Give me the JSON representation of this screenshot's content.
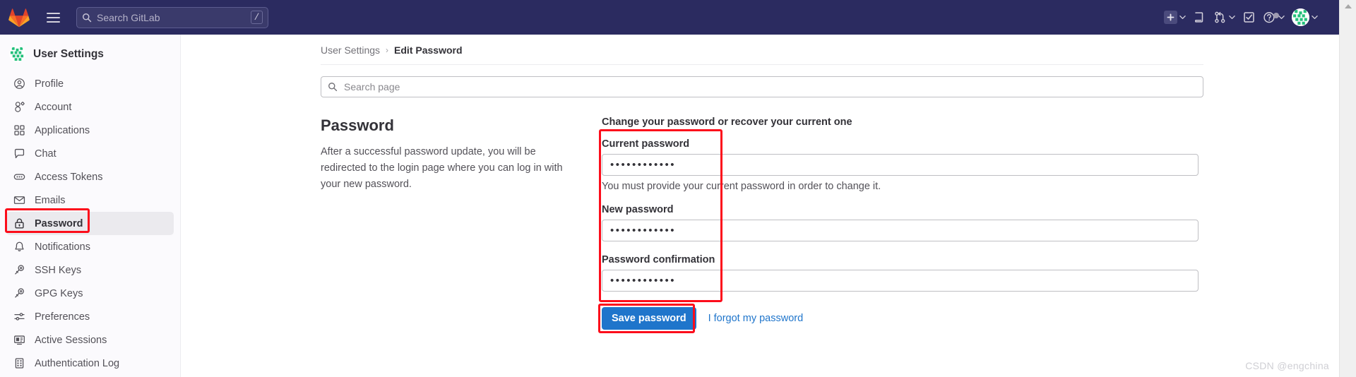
{
  "navbar": {
    "logo_icon": "gitlab-logo-icon",
    "hamburger_icon": "hamburger-menu-icon",
    "search": {
      "placeholder": "Search GitLab",
      "value": "",
      "icon": "search-icon",
      "shortcut_key": "/"
    },
    "actions": [
      {
        "name": "create-new-menu",
        "icon": "plus-square-icon",
        "has_chevron": true
      },
      {
        "name": "issues-link",
        "icon": "issues-icon",
        "has_chevron": false
      },
      {
        "name": "merge-requests-menu",
        "icon": "merge-request-icon",
        "has_chevron": true
      },
      {
        "name": "todos-link",
        "icon": "todo-check-square-icon",
        "has_chevron": false
      },
      {
        "name": "help-menu",
        "icon": "question-circle-icon",
        "has_chevron": true,
        "badge": true
      },
      {
        "name": "user-menu",
        "icon": "user-avatar-icon",
        "has_chevron": true
      }
    ]
  },
  "sidebar": {
    "header": {
      "title": "User Settings",
      "avatar_icon": "user-avatar-icon"
    },
    "items": [
      {
        "label": "Profile",
        "icon": "user-circle-icon",
        "active": false
      },
      {
        "label": "Account",
        "icon": "account-gear-icon",
        "active": false
      },
      {
        "label": "Applications",
        "icon": "applications-grid-icon",
        "active": false
      },
      {
        "label": "Chat",
        "icon": "chat-bubble-icon",
        "active": false
      },
      {
        "label": "Access Tokens",
        "icon": "token-ellipsis-icon",
        "active": false
      },
      {
        "label": "Emails",
        "icon": "envelope-icon",
        "active": false
      },
      {
        "label": "Password",
        "icon": "lock-icon",
        "active": true
      },
      {
        "label": "Notifications",
        "icon": "bell-icon",
        "active": false
      },
      {
        "label": "SSH Keys",
        "icon": "key-icon",
        "active": false
      },
      {
        "label": "GPG Keys",
        "icon": "key-icon",
        "active": false
      },
      {
        "label": "Preferences",
        "icon": "sliders-icon",
        "active": false
      },
      {
        "label": "Active Sessions",
        "icon": "monitor-icon",
        "active": false
      },
      {
        "label": "Authentication Log",
        "icon": "log-list-icon",
        "active": false
      }
    ]
  },
  "breadcrumb": {
    "parent": "User Settings",
    "separator": "›",
    "current": "Edit Password"
  },
  "page_search": {
    "placeholder": "Search page",
    "value": "",
    "icon": "search-icon"
  },
  "content": {
    "heading": "Password",
    "description": "After a successful password update, you will be redirected to the login page where you can log in with your new password."
  },
  "form": {
    "title": "Change your password or recover your current one",
    "fields": [
      {
        "label": "Current password",
        "value": "••••••••••••",
        "help": "You must provide your current password in order to change it."
      },
      {
        "label": "New password",
        "value": "••••••••••••",
        "help": ""
      },
      {
        "label": "Password confirmation",
        "value": "••••••••••••",
        "help": ""
      }
    ],
    "submit_label": "Save password",
    "forgot_link": "I forgot my password"
  },
  "colors": {
    "navbar_bg": "#2b2b60",
    "sidebar_bg": "#fbfafd",
    "primary_button": "#1f75cb",
    "link": "#1f75cb",
    "annotation": "#fc0d1b",
    "active_item_bg": "#ebeaee"
  },
  "watermark": "CSDN @engchina",
  "scrollbar": {
    "up_arrow_icon": "scroll-up-arrow-icon"
  }
}
